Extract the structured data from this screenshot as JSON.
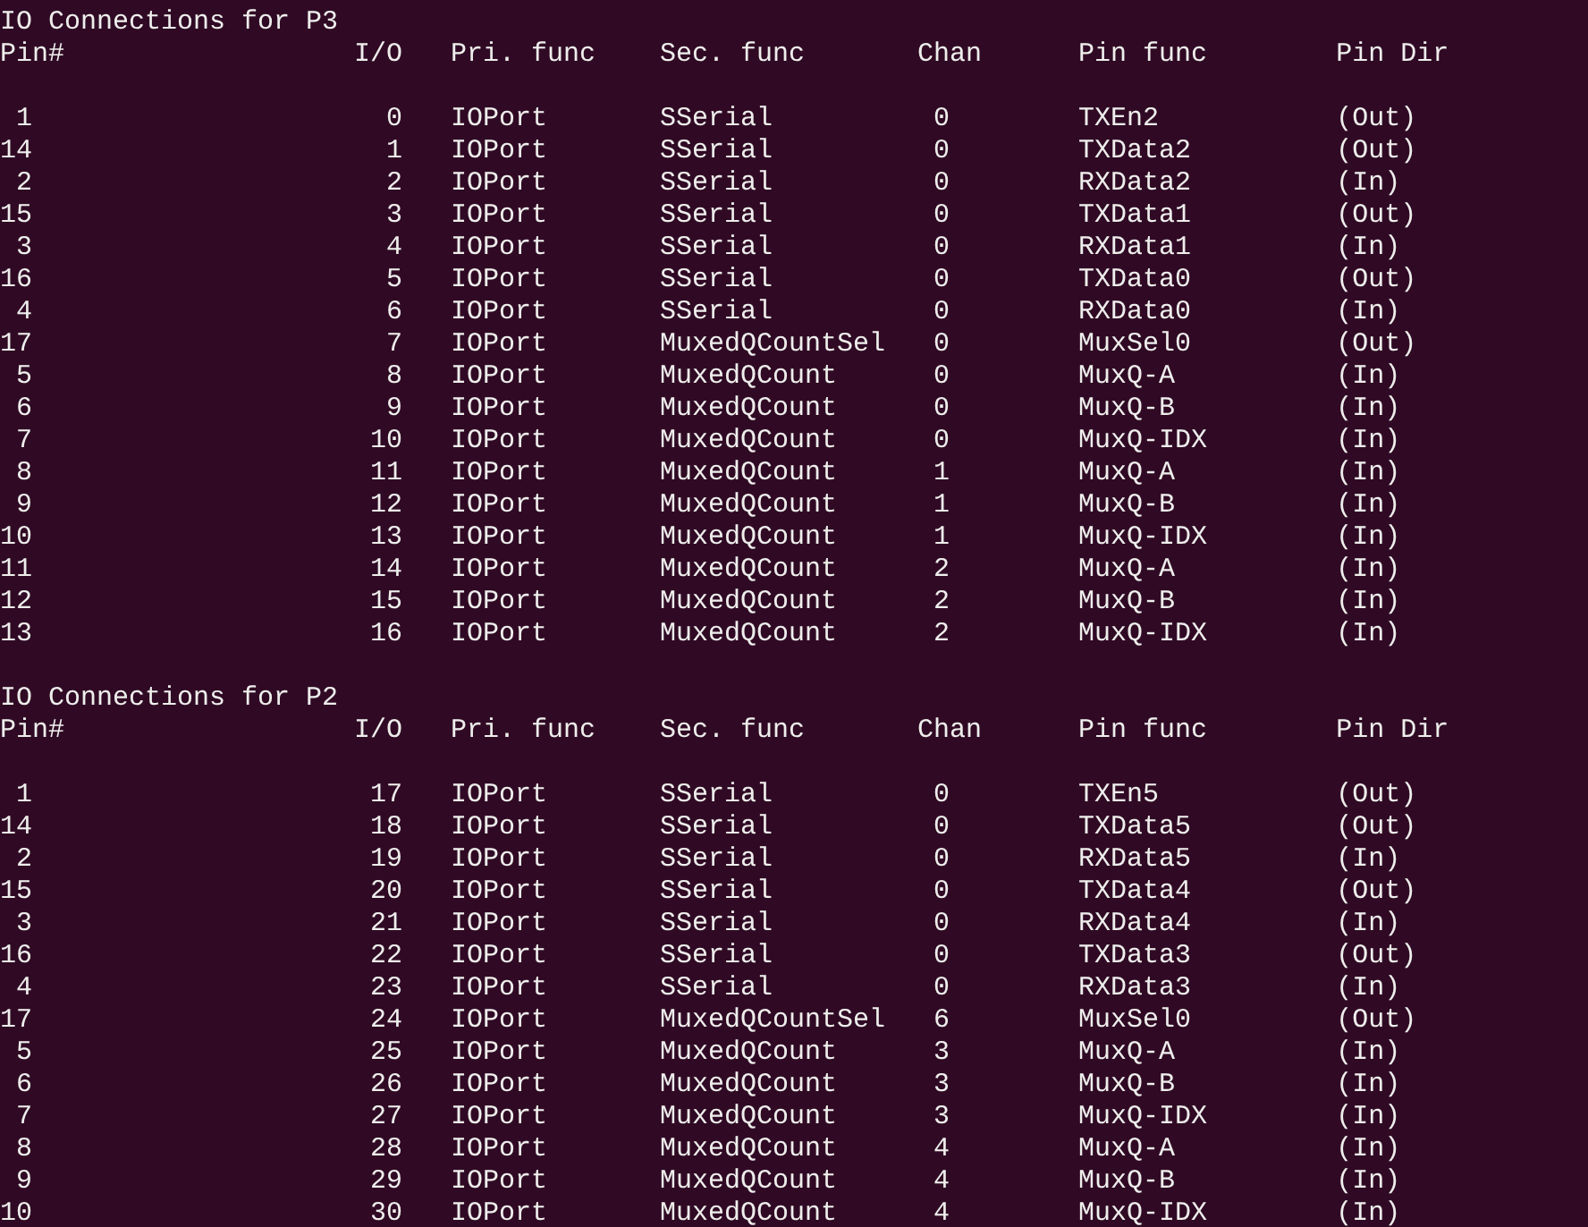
{
  "sections": [
    {
      "title": "IO Connections for P3",
      "columns": [
        "Pin#",
        "I/O",
        "Pri. func",
        "Sec. func",
        "Chan",
        "Pin func",
        "Pin Dir"
      ],
      "rows": [
        [
          "1",
          "0",
          "IOPort",
          "SSerial",
          "0",
          "TXEn2",
          "(Out)"
        ],
        [
          "14",
          "1",
          "IOPort",
          "SSerial",
          "0",
          "TXData2",
          "(Out)"
        ],
        [
          "2",
          "2",
          "IOPort",
          "SSerial",
          "0",
          "RXData2",
          "(In)"
        ],
        [
          "15",
          "3",
          "IOPort",
          "SSerial",
          "0",
          "TXData1",
          "(Out)"
        ],
        [
          "3",
          "4",
          "IOPort",
          "SSerial",
          "0",
          "RXData1",
          "(In)"
        ],
        [
          "16",
          "5",
          "IOPort",
          "SSerial",
          "0",
          "TXData0",
          "(Out)"
        ],
        [
          "4",
          "6",
          "IOPort",
          "SSerial",
          "0",
          "RXData0",
          "(In)"
        ],
        [
          "17",
          "7",
          "IOPort",
          "MuxedQCountSel",
          "0",
          "MuxSel0",
          "(Out)"
        ],
        [
          "5",
          "8",
          "IOPort",
          "MuxedQCount",
          "0",
          "MuxQ-A",
          "(In)"
        ],
        [
          "6",
          "9",
          "IOPort",
          "MuxedQCount",
          "0",
          "MuxQ-B",
          "(In)"
        ],
        [
          "7",
          "10",
          "IOPort",
          "MuxedQCount",
          "0",
          "MuxQ-IDX",
          "(In)"
        ],
        [
          "8",
          "11",
          "IOPort",
          "MuxedQCount",
          "1",
          "MuxQ-A",
          "(In)"
        ],
        [
          "9",
          "12",
          "IOPort",
          "MuxedQCount",
          "1",
          "MuxQ-B",
          "(In)"
        ],
        [
          "10",
          "13",
          "IOPort",
          "MuxedQCount",
          "1",
          "MuxQ-IDX",
          "(In)"
        ],
        [
          "11",
          "14",
          "IOPort",
          "MuxedQCount",
          "2",
          "MuxQ-A",
          "(In)"
        ],
        [
          "12",
          "15",
          "IOPort",
          "MuxedQCount",
          "2",
          "MuxQ-B",
          "(In)"
        ],
        [
          "13",
          "16",
          "IOPort",
          "MuxedQCount",
          "2",
          "MuxQ-IDX",
          "(In)"
        ]
      ]
    },
    {
      "title": "IO Connections for P2",
      "columns": [
        "Pin#",
        "I/O",
        "Pri. func",
        "Sec. func",
        "Chan",
        "Pin func",
        "Pin Dir"
      ],
      "rows": [
        [
          "1",
          "17",
          "IOPort",
          "SSerial",
          "0",
          "TXEn5",
          "(Out)"
        ],
        [
          "14",
          "18",
          "IOPort",
          "SSerial",
          "0",
          "TXData5",
          "(Out)"
        ],
        [
          "2",
          "19",
          "IOPort",
          "SSerial",
          "0",
          "RXData5",
          "(In)"
        ],
        [
          "15",
          "20",
          "IOPort",
          "SSerial",
          "0",
          "TXData4",
          "(Out)"
        ],
        [
          "3",
          "21",
          "IOPort",
          "SSerial",
          "0",
          "RXData4",
          "(In)"
        ],
        [
          "16",
          "22",
          "IOPort",
          "SSerial",
          "0",
          "TXData3",
          "(Out)"
        ],
        [
          "4",
          "23",
          "IOPort",
          "SSerial",
          "0",
          "RXData3",
          "(In)"
        ],
        [
          "17",
          "24",
          "IOPort",
          "MuxedQCountSel",
          "6",
          "MuxSel0",
          "(Out)"
        ],
        [
          "5",
          "25",
          "IOPort",
          "MuxedQCount",
          "3",
          "MuxQ-A",
          "(In)"
        ],
        [
          "6",
          "26",
          "IOPort",
          "MuxedQCount",
          "3",
          "MuxQ-B",
          "(In)"
        ],
        [
          "7",
          "27",
          "IOPort",
          "MuxedQCount",
          "3",
          "MuxQ-IDX",
          "(In)"
        ],
        [
          "8",
          "28",
          "IOPort",
          "MuxedQCount",
          "4",
          "MuxQ-A",
          "(In)"
        ],
        [
          "9",
          "29",
          "IOPort",
          "MuxedQCount",
          "4",
          "MuxQ-B",
          "(In)"
        ],
        [
          "10",
          "30",
          "IOPort",
          "MuxedQCount",
          "4",
          "MuxQ-IDX",
          "(In)"
        ]
      ]
    }
  ]
}
